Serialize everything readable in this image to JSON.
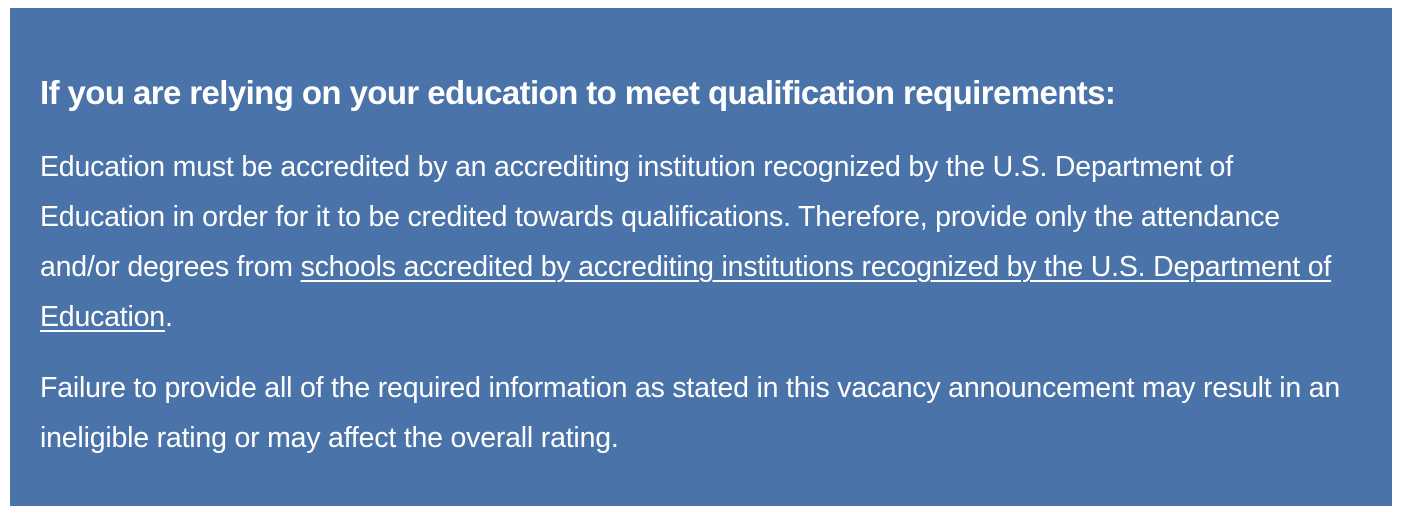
{
  "callout": {
    "title": "If you are relying on your education to meet qualification requirements:",
    "paragraph1": {
      "text_before_link": "Education must be accredited by an accrediting institution recognized by the U.S. Department of Education in order for it to be credited towards qualifications. Therefore, provide only the attendance and/or degrees from ",
      "link_text": "schools accredited by accrediting institutions recognized by the U.S. Department of Education",
      "text_after_link": "."
    },
    "paragraph2": "Failure to provide all of the required information as stated in this vacancy announcement may result in an ineligible rating or may affect the overall rating.",
    "colors": {
      "background": "#4973a9",
      "text": "#ffffff"
    }
  }
}
